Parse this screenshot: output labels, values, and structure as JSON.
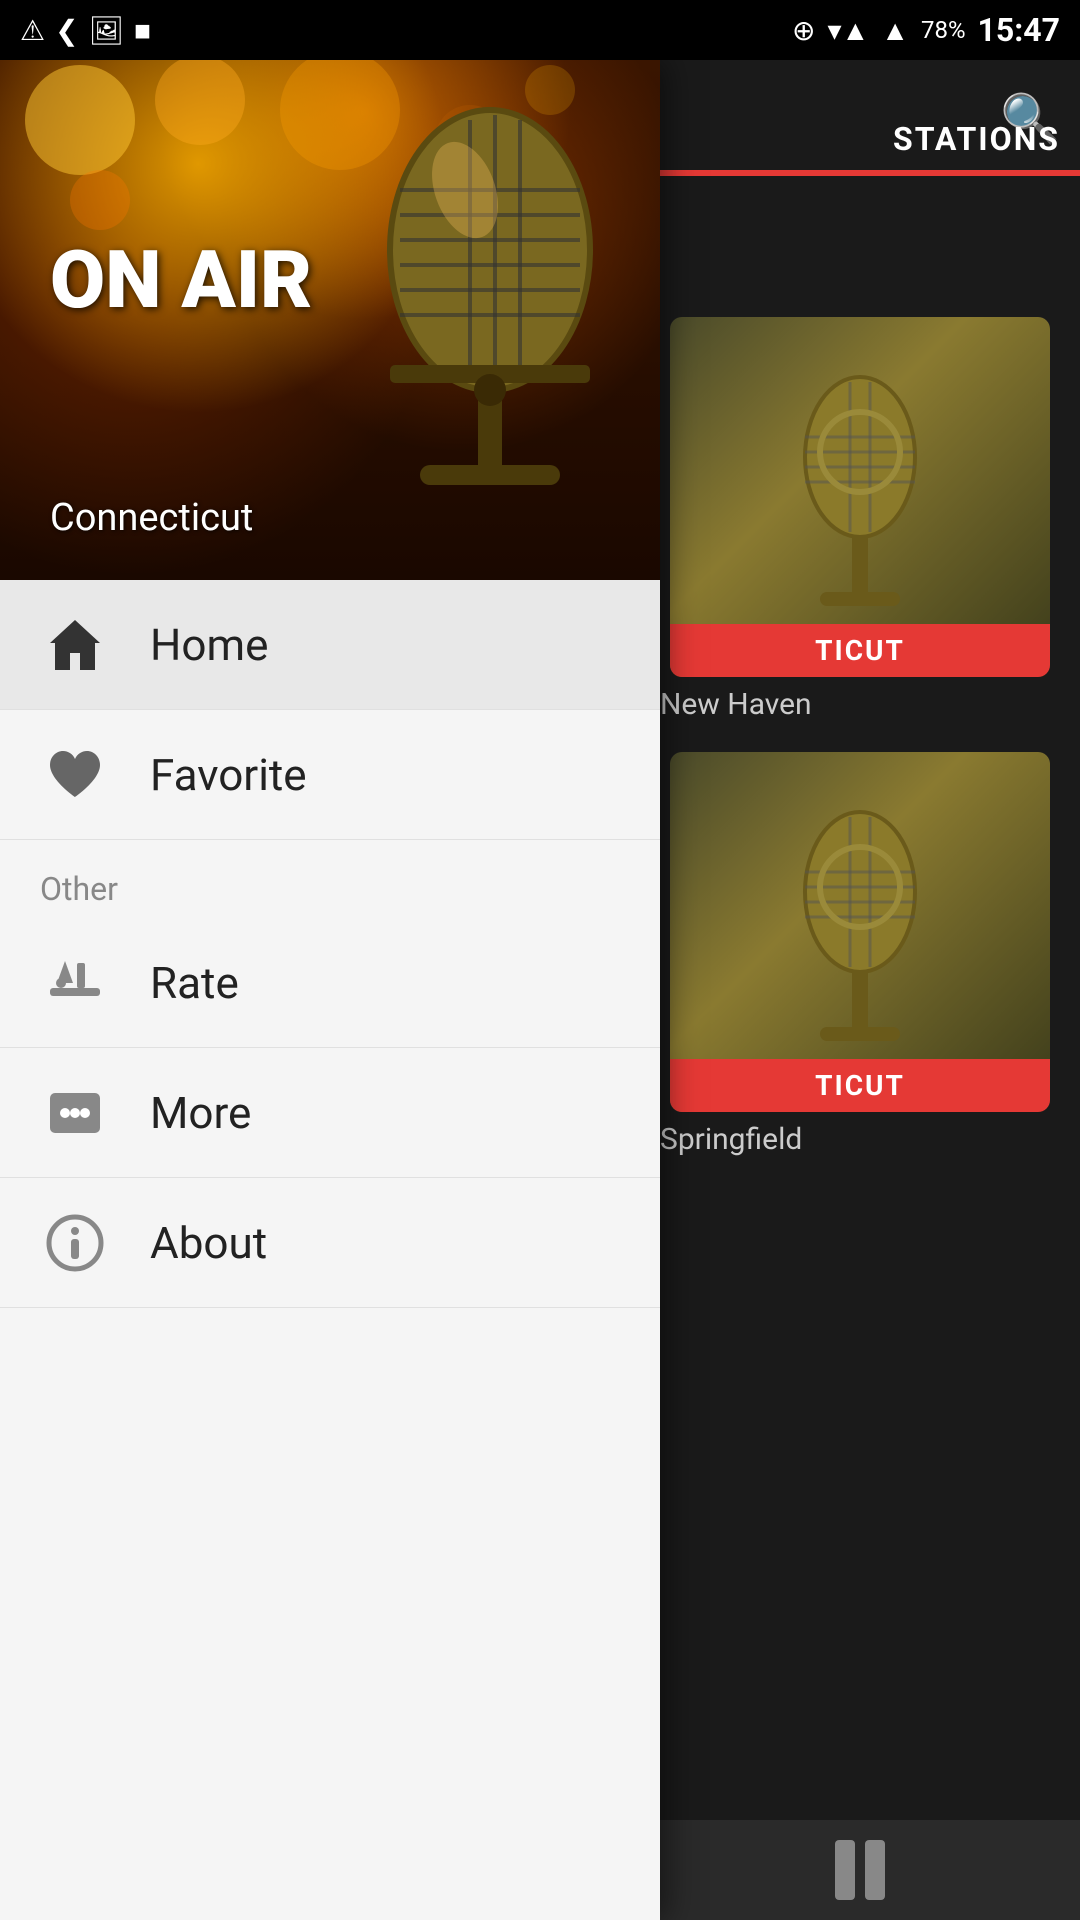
{
  "statusBar": {
    "time": "15:47",
    "battery": "78%"
  },
  "header": {
    "stationsLabel": "STATIONS",
    "searchIconLabel": "search"
  },
  "hero": {
    "onAir": "ON\nAIR",
    "subtitle": "Connecticut"
  },
  "menu": {
    "mainItems": [
      {
        "id": "home",
        "label": "Home",
        "icon": "home"
      },
      {
        "id": "favorite",
        "label": "Favorite",
        "icon": "heart"
      }
    ],
    "sectionLabel": "Other",
    "otherItems": [
      {
        "id": "rate",
        "label": "Rate",
        "icon": "pencil"
      },
      {
        "id": "more",
        "label": "More",
        "icon": "more"
      },
      {
        "id": "about",
        "label": "About",
        "icon": "info"
      }
    ]
  },
  "stations": [
    {
      "id": "station1",
      "label": "TICUT",
      "name": "New Haven"
    },
    {
      "id": "station2",
      "label": "TICUT",
      "name": "Springfield"
    }
  ]
}
